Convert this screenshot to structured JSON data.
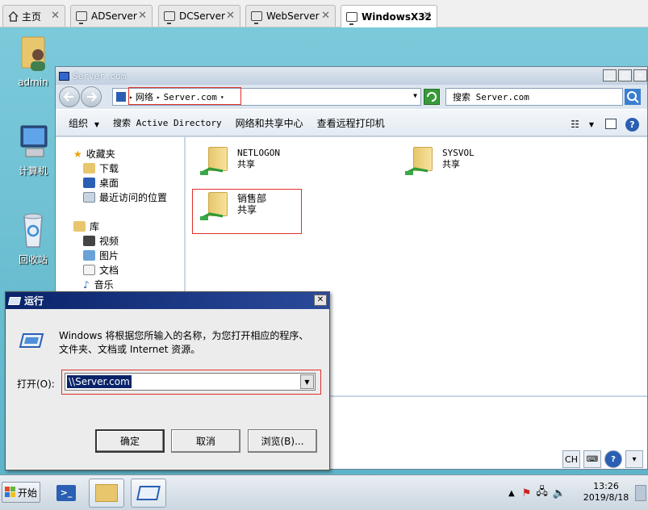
{
  "tabs": [
    {
      "label": "主页",
      "active": false
    },
    {
      "label": "ADServer",
      "active": false
    },
    {
      "label": "DCServer",
      "active": false
    },
    {
      "label": "WebServer",
      "active": false
    },
    {
      "label": "WindowsX32",
      "active": true
    }
  ],
  "desktop_icons": [
    {
      "label": "admin",
      "icon": "user-folder-icon"
    },
    {
      "label": "计算机",
      "icon": "computer-icon"
    },
    {
      "label": "回收站",
      "icon": "recycle-bin-icon"
    }
  ],
  "explorer": {
    "title": "Server.com",
    "address": {
      "root": "网络",
      "location": "Server.com"
    },
    "search_placeholder": "搜索 Server.com",
    "commands": {
      "organize": "组织",
      "search_ad": "搜索 Active Directory",
      "network_center": "网络和共享中心",
      "printers": "查看远程打印机"
    },
    "nav": {
      "favorites": "收藏夹",
      "downloads": "下载",
      "desktop": "桌面",
      "recent": "最近访问的位置",
      "libraries": "库",
      "videos": "视频",
      "pictures": "图片",
      "documents": "文档",
      "music": "音乐"
    },
    "shares": [
      {
        "name": "NETLOGON",
        "type": "共享"
      },
      {
        "name": "SYSVOL",
        "type": "共享"
      },
      {
        "name": "销售部",
        "type": "共享"
      }
    ]
  },
  "run_dialog": {
    "title": "运行",
    "description": "Windows 将根据您所输入的名称，为您打开相应的程序、文件夹、文档或 Internet 资源。",
    "open_label": "打开(O):",
    "open_value": "\\\\Server.com",
    "ok": "确定",
    "cancel": "取消",
    "browse": "浏览(B)..."
  },
  "taskbar": {
    "start": "开始",
    "lang": "CH",
    "time": "13:26",
    "date": "2019/8/18"
  },
  "colors": {
    "highlight_box": "#e0302a",
    "title_active": "#0a246a"
  }
}
